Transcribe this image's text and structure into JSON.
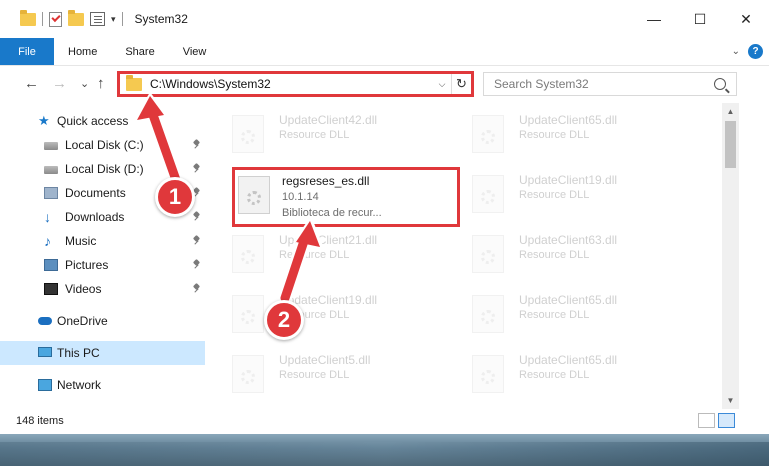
{
  "window": {
    "title": "System32",
    "controls": {
      "minimize": "—",
      "maximize": "☐",
      "close": "✕"
    }
  },
  "ribbon": {
    "tabs": [
      "File",
      "Home",
      "Share",
      "View"
    ],
    "help": "?"
  },
  "address": {
    "path": "C:\\Windows\\System32",
    "dropdown": "⌵",
    "refresh": "↻"
  },
  "search": {
    "placeholder": "Search System32"
  },
  "nav": {
    "back": "←",
    "forward": "→",
    "recent": "⌄",
    "up": "↑"
  },
  "sidebar": {
    "items": [
      {
        "label": "Quick access",
        "icon": "star-icon",
        "pinned": false
      },
      {
        "label": "Local Disk (C:)",
        "icon": "drive-icon",
        "pinned": true
      },
      {
        "label": "Local Disk (D:)",
        "icon": "drive-icon",
        "pinned": true
      },
      {
        "label": "Documents",
        "icon": "documents-icon",
        "pinned": true
      },
      {
        "label": "Downloads",
        "icon": "downloads-icon",
        "pinned": true
      },
      {
        "label": "Music",
        "icon": "music-icon",
        "pinned": true
      },
      {
        "label": "Pictures",
        "icon": "pictures-icon",
        "pinned": true
      },
      {
        "label": "Videos",
        "icon": "videos-icon",
        "pinned": true
      },
      {
        "label": "OneDrive",
        "icon": "onedrive-icon",
        "pinned": false
      },
      {
        "label": "This PC",
        "icon": "pc-icon",
        "pinned": false,
        "selected": true
      },
      {
        "label": "Network",
        "icon": "network-icon",
        "pinned": false
      }
    ]
  },
  "files": {
    "left": [
      {
        "name": "UpdateClient42.dll",
        "type": "Resource DLL"
      },
      {
        "name": "regsreses_es.dll",
        "version": "10.1.14",
        "description": "Biblioteca de recur...",
        "highlighted": true
      },
      {
        "name": "UpdateClient21.dll",
        "type": "Resource DLL"
      },
      {
        "name": "UpdateClient19.dll",
        "type": "Resource DLL"
      },
      {
        "name": "UpdateClient5.dll",
        "type": "Resource DLL"
      }
    ],
    "right": [
      {
        "name": "UpdateClient65.dll",
        "type": "Resource DLL"
      },
      {
        "name": "UpdateClient19.dll",
        "type": "Resource DLL"
      },
      {
        "name": "UpdateClient63.dll",
        "type": "Resource DLL"
      },
      {
        "name": "UpdateClient65.dll",
        "type": "Resource DLL"
      },
      {
        "name": "UpdateClient65.dll",
        "type": "Resource DLL"
      }
    ]
  },
  "status": {
    "item_count": "148 items"
  },
  "callouts": {
    "step1": "1",
    "step2": "2"
  },
  "colors": {
    "accent": "#1979ca",
    "highlight": "#e0383b",
    "selected_bg": "#cce8ff"
  }
}
